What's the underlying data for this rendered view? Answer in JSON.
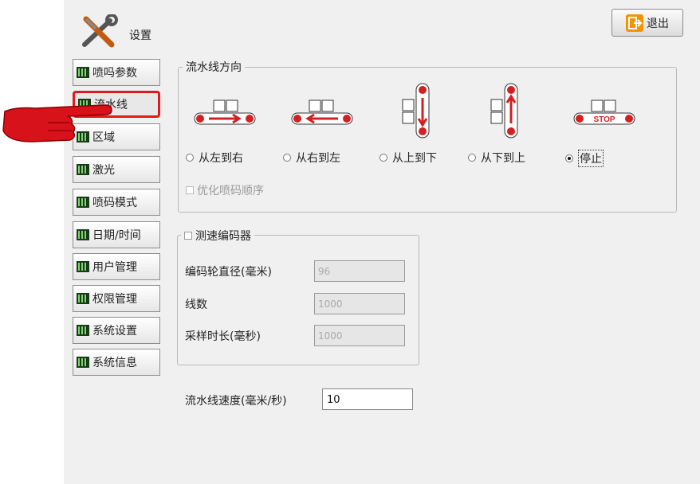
{
  "header": {
    "title": "设置",
    "exit_label": "退出"
  },
  "sidebar": {
    "items": [
      {
        "label": "喷吗参数"
      },
      {
        "label": "流水线",
        "active": true
      },
      {
        "label": "区域"
      },
      {
        "label": "激光"
      },
      {
        "label": "喷码模式"
      },
      {
        "label": "日期/时间"
      },
      {
        "label": "用户管理"
      },
      {
        "label": "权限管理"
      },
      {
        "label": "系统设置"
      },
      {
        "label": "系统信息"
      }
    ]
  },
  "direction": {
    "legend": "流水线方向",
    "options": [
      {
        "label": "从左到右",
        "icon": "left-to-right-conveyor-icon",
        "selected": false
      },
      {
        "label": "从右到左",
        "icon": "right-to-left-conveyor-icon",
        "selected": false
      },
      {
        "label": "从上到下",
        "icon": "top-to-bottom-conveyor-icon",
        "selected": false
      },
      {
        "label": "从下到上",
        "icon": "bottom-to-top-conveyor-icon",
        "selected": false
      },
      {
        "label": "停止",
        "icon": "stop-conveyor-icon",
        "selected": true
      }
    ],
    "stop_text": "STOP",
    "optimize_label": "优化喷码顺序"
  },
  "encoder": {
    "legend": "测速编码器",
    "wheel_diameter_label": "编码轮直径(毫米)",
    "wheel_diameter_value": "96",
    "lines_label": "线数",
    "lines_value": "1000",
    "sample_time_label": "采样时长(毫秒)",
    "sample_time_value": "1000"
  },
  "speed": {
    "label": "流水线速度(毫米/秒)",
    "value": "10"
  },
  "colors": {
    "accent_red": "#e01a1a",
    "exit_orange": "#f29400",
    "panel_bg": "#f0f0f0"
  }
}
